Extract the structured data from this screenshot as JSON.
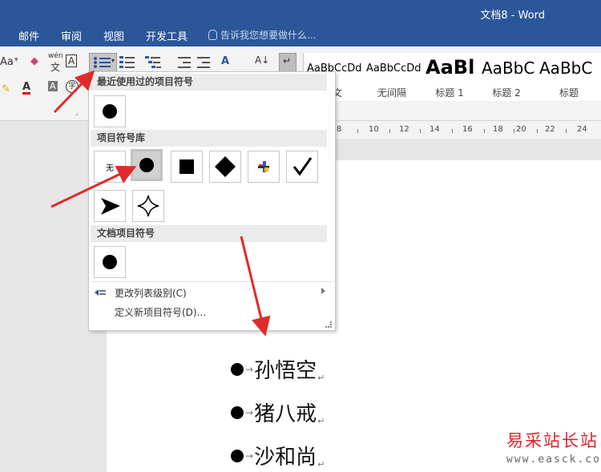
{
  "window": {
    "title": "文档8 - Word"
  },
  "ribbon_tabs": [
    "邮件",
    "审阅",
    "视图",
    "开发工具"
  ],
  "tell_me": "告诉我您想要做什么...",
  "ribbon": {
    "font_case_label": "Aa",
    "phonetic_label": "wén",
    "phonetic_char": "文",
    "char_border_label": "A",
    "font_color_label": "A",
    "char_shading_label": "A",
    "enclose_char_label": "字",
    "sort_label": "A↓",
    "text_direction_label": "A"
  },
  "styles": [
    {
      "sample": "AaBbCcDd",
      "name": "正文"
    },
    {
      "sample": "AaBbCcDd",
      "name": "无间隔"
    },
    {
      "sample": "AaBl",
      "name": "标题 1"
    },
    {
      "sample": "AaBbC",
      "name": "标题 2"
    },
    {
      "sample": "AaBbC",
      "name": "标题"
    }
  ],
  "ruler_labels": [
    "8",
    "10",
    "12",
    "14",
    "16",
    "18",
    "20",
    "22",
    "24"
  ],
  "bullet_menu": {
    "recent_header": "最近使用过的项目符号",
    "library_header": "项目符号库",
    "none_label": "无",
    "document_header": "文档项目符号",
    "change_level": "更改列表级别(C)",
    "define_new": "定义新项目符号(D)..."
  },
  "document_lines": [
    "孙悟空",
    "猪八戒",
    "沙和尚"
  ],
  "watermark": {
    "name": "易采站长站",
    "url": "www.easck.com"
  },
  "colors": {
    "title_bar": "#2b579a",
    "annotation_arrow": "#e02b2b",
    "watermark": "#e0232b"
  }
}
